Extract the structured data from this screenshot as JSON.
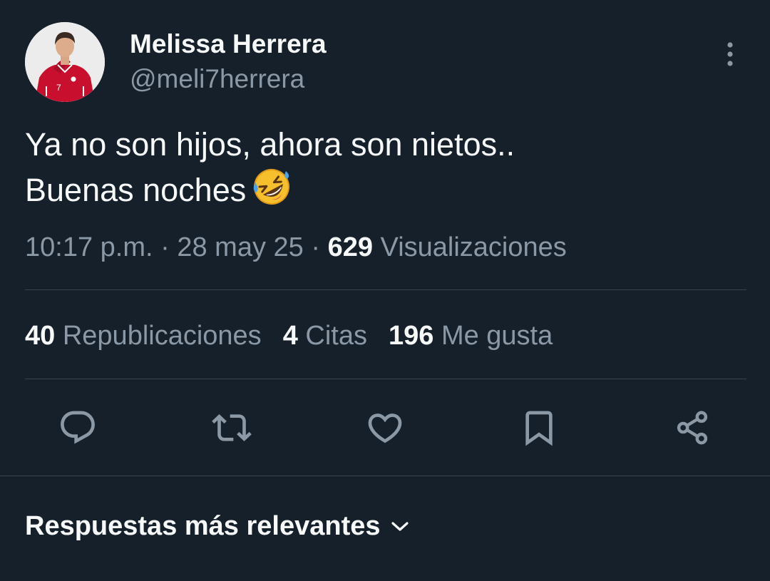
{
  "author": {
    "display_name": "Melissa Herrera",
    "handle": "@meli7herrera"
  },
  "tweet": {
    "line1": "Ya no son hijos, ahora son nietos..",
    "line2": "Buenas noches",
    "emoji": "rolling-on-the-floor-laughing-emoji",
    "time": "10:17 p.m.",
    "date": "28 may 25",
    "views_count": "629",
    "views_label": "Visualizaciones"
  },
  "stats": {
    "reposts_count": "40",
    "reposts_label": "Republicaciones",
    "quotes_count": "4",
    "quotes_label": "Citas",
    "likes_count": "196",
    "likes_label": "Me gusta"
  },
  "actions": [
    "reply-icon",
    "repost-icon",
    "like-icon",
    "bookmark-icon",
    "share-icon"
  ],
  "replies_sort": {
    "label": "Respuestas más relevantes"
  },
  "colors": {
    "background": "#15202b",
    "primary_text": "#f7f9f9",
    "secondary_text": "#8b98a5",
    "divider": "#38444d"
  }
}
